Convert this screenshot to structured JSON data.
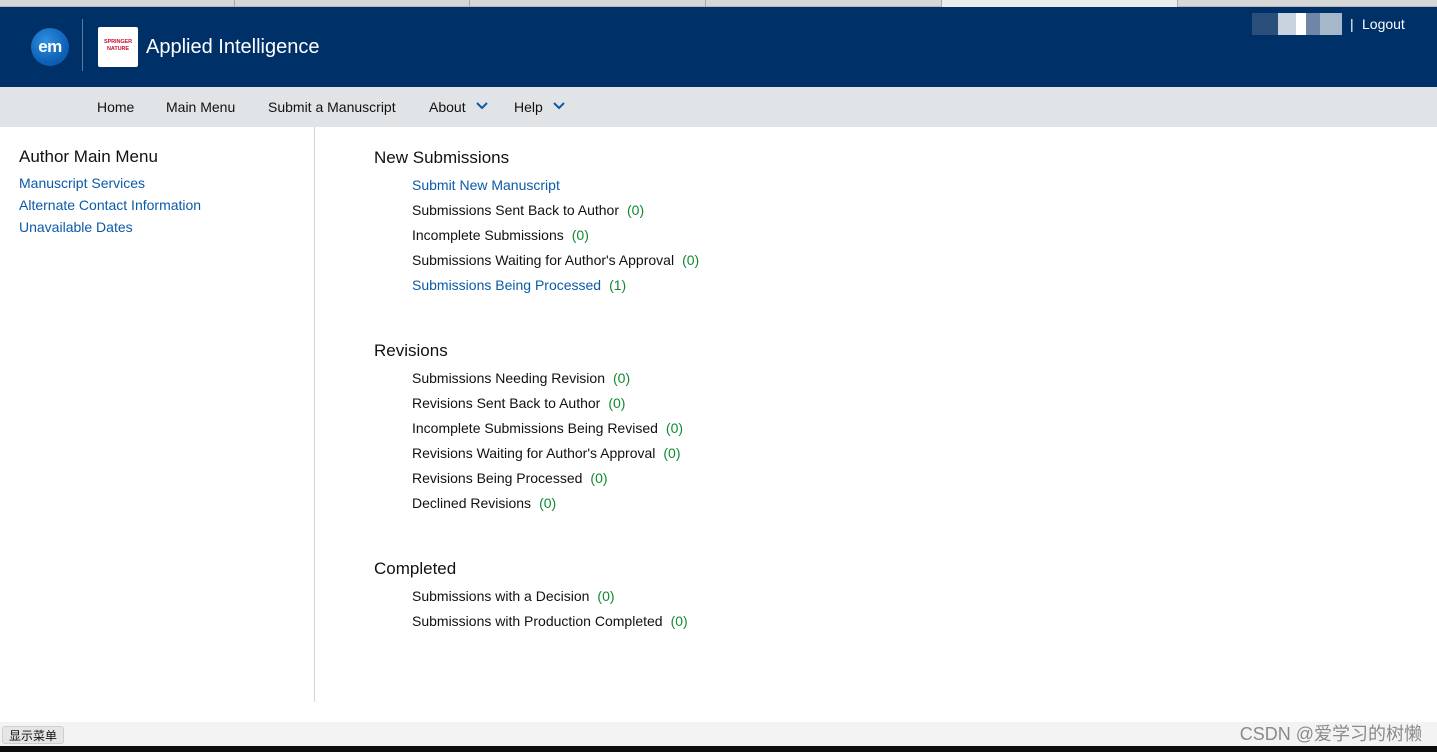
{
  "header": {
    "journal_title": "Applied Intelligence",
    "em_logo_text": "em",
    "publisher_logo_line1": "SPRINGER",
    "publisher_logo_line2": "NATURE",
    "logout_separator": "|",
    "logout_label": "Logout",
    "colors": {
      "header_bg": "#003068",
      "navbar_bg": "#e0e4e7",
      "link": "#0b5aa8",
      "count": "#108a2f"
    }
  },
  "nav": {
    "items": [
      {
        "label": "Home"
      },
      {
        "label": "Main Menu"
      },
      {
        "label": "Submit a Manuscript"
      },
      {
        "label": "About",
        "icon": "chevron-down-icon"
      },
      {
        "label": "Help",
        "icon": "chevron-down-icon"
      }
    ]
  },
  "sidebar": {
    "title": "Author Main Menu",
    "links": [
      {
        "label": "Manuscript Services"
      },
      {
        "label": "Alternate Contact Information"
      },
      {
        "label": "Unavailable Dates"
      }
    ]
  },
  "sections": [
    {
      "title": "New Submissions",
      "items": [
        {
          "label": "Submit New Manuscript",
          "count": "",
          "link": true
        },
        {
          "label": "Submissions Sent Back to Author",
          "count": "(0)",
          "link": false
        },
        {
          "label": "Incomplete Submissions",
          "count": "(0)",
          "link": false
        },
        {
          "label": "Submissions Waiting for Author's Approval",
          "count": "(0)",
          "link": false
        },
        {
          "label": "Submissions Being Processed",
          "count": "(1)",
          "link": true
        }
      ]
    },
    {
      "title": "Revisions",
      "items": [
        {
          "label": "Submissions Needing Revision",
          "count": "(0)",
          "link": false
        },
        {
          "label": "Revisions Sent Back to Author",
          "count": "(0)",
          "link": false
        },
        {
          "label": "Incomplete Submissions Being Revised",
          "count": "(0)",
          "link": false
        },
        {
          "label": "Revisions Waiting for Author's Approval",
          "count": "(0)",
          "link": false
        },
        {
          "label": "Revisions Being Processed",
          "count": "(0)",
          "link": false
        },
        {
          "label": "Declined Revisions",
          "count": "(0)",
          "link": false
        }
      ]
    },
    {
      "title": "Completed",
      "items": [
        {
          "label": "Submissions with a Decision",
          "count": "(0)",
          "link": false
        },
        {
          "label": "Submissions with Production Completed",
          "count": "(0)",
          "link": false
        }
      ]
    }
  ],
  "statusbar": {
    "text": "显示菜单",
    "watermark": "CSDN @爱学习的树懒"
  }
}
